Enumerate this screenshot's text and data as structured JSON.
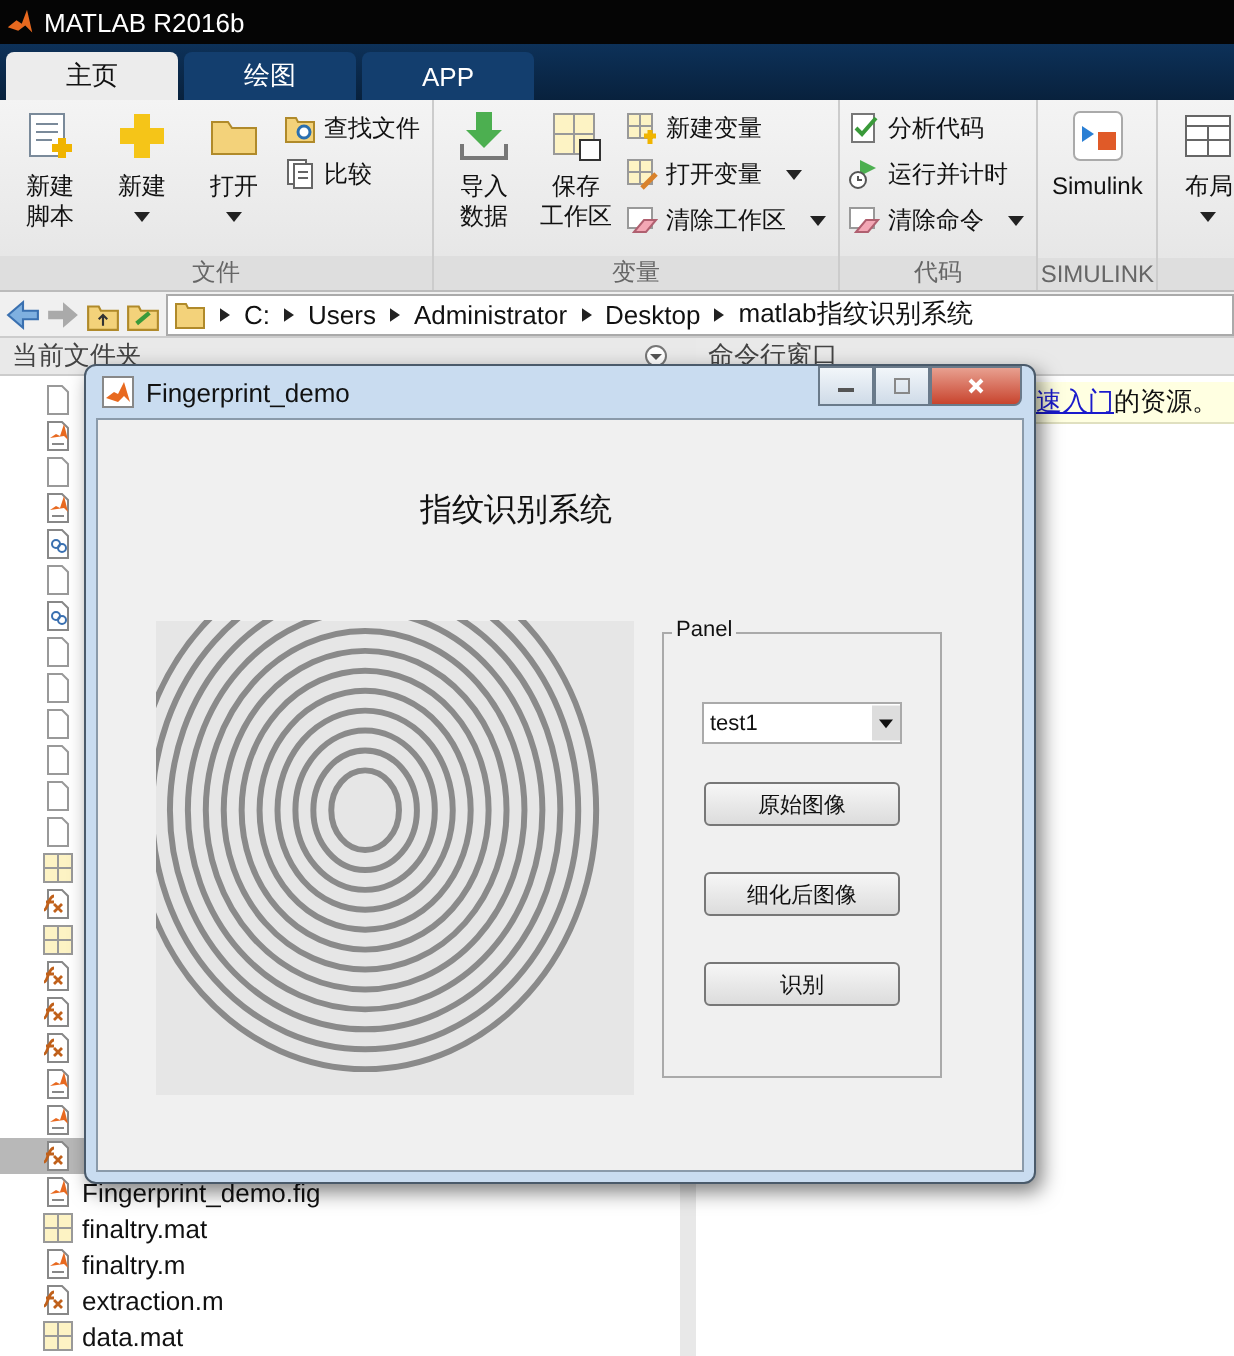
{
  "window": {
    "title": "MATLAB R2016b"
  },
  "tabs": [
    {
      "label": "主页",
      "selected": true
    },
    {
      "label": "绘图",
      "selected": false
    },
    {
      "label": "APP",
      "selected": false
    }
  ],
  "ribbon": {
    "sections": [
      {
        "label": "文件",
        "items": [
          {
            "kind": "large",
            "lines": [
              "新建",
              "脚本"
            ],
            "has_menu": false
          },
          {
            "kind": "large",
            "lines": [
              "新建"
            ],
            "has_menu": true
          },
          {
            "kind": "large",
            "lines": [
              "打开"
            ],
            "has_menu": true
          },
          {
            "kind": "stack",
            "buttons": [
              {
                "label": "查找文件",
                "has_menu": false
              },
              {
                "label": "比较",
                "has_menu": false
              }
            ]
          }
        ]
      },
      {
        "label": "变量",
        "items": [
          {
            "kind": "large",
            "lines": [
              "导入",
              "数据"
            ],
            "has_menu": false
          },
          {
            "kind": "large",
            "lines": [
              "保存",
              "工作区"
            ],
            "has_menu": false
          },
          {
            "kind": "stack",
            "buttons": [
              {
                "label": "新建变量",
                "has_menu": false
              },
              {
                "label": "打开变量",
                "has_menu": true
              },
              {
                "label": "清除工作区",
                "has_menu": true
              }
            ]
          }
        ]
      },
      {
        "label": "代码",
        "items": [
          {
            "kind": "stack",
            "buttons": [
              {
                "label": "分析代码",
                "has_menu": false
              },
              {
                "label": "运行并计时",
                "has_menu": false
              },
              {
                "label": "清除命令",
                "has_menu": true
              }
            ]
          }
        ]
      },
      {
        "label": "SIMULINK",
        "items": [
          {
            "kind": "large",
            "lines": [
              "Simulink"
            ],
            "has_menu": false
          }
        ]
      },
      {
        "items": [
          {
            "kind": "large",
            "lines": [
              "布局"
            ],
            "has_menu": true
          }
        ]
      }
    ]
  },
  "address_bar": {
    "path": [
      "C:",
      "Users",
      "Administrator",
      "Desktop",
      "matlab指纹识别系统"
    ]
  },
  "file_panel": {
    "title": "当前文件夹",
    "files": [
      {
        "kind": "blank",
        "selected": false
      },
      {
        "kind": "script",
        "selected": false
      },
      {
        "kind": "blank",
        "selected": false
      },
      {
        "kind": "script",
        "selected": false
      },
      {
        "kind": "linked",
        "selected": false
      },
      {
        "kind": "blank",
        "selected": false
      },
      {
        "kind": "linked",
        "selected": false
      },
      {
        "kind": "blank",
        "selected": false
      },
      {
        "kind": "blank",
        "selected": false
      },
      {
        "kind": "blank",
        "selected": false
      },
      {
        "kind": "blank",
        "selected": false
      },
      {
        "kind": "blank",
        "selected": false
      },
      {
        "kind": "blank",
        "selected": false
      },
      {
        "kind": "data",
        "selected": false
      },
      {
        "kind": "function",
        "selected": false
      },
      {
        "kind": "data",
        "selected": false
      },
      {
        "kind": "function",
        "selected": false
      },
      {
        "kind": "function",
        "selected": false
      },
      {
        "kind": "function",
        "selected": false
      },
      {
        "kind": "script",
        "selected": false
      },
      {
        "kind": "script",
        "selected": false
      },
      {
        "kind": "function",
        "selected": true
      },
      {
        "kind": "script",
        "name": "Fingerprint_demo.fig",
        "selected": false
      },
      {
        "kind": "data",
        "name": "finaltry.mat",
        "selected": false
      },
      {
        "kind": "script",
        "name": "finaltry.m",
        "selected": false
      },
      {
        "kind": "function",
        "name": "extraction.m",
        "selected": false
      },
      {
        "kind": "data",
        "name": "data.mat",
        "selected": false
      }
    ]
  },
  "command_panel": {
    "title": "命令行窗口",
    "notice": {
      "link": "速入门",
      "text": "的资源。"
    }
  },
  "dialog": {
    "title": "Fingerprint_demo",
    "heading": "指纹识别系统",
    "panel": {
      "title": "Panel",
      "dropdown": {
        "value": "test1"
      },
      "buttons": [
        "原始图像",
        "细化后图像",
        "识别"
      ]
    }
  }
}
